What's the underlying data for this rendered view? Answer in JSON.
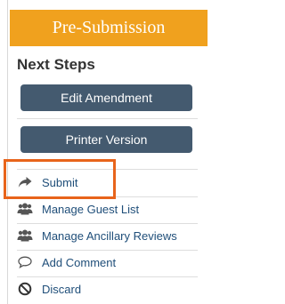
{
  "header": {
    "title": "Pre-Submission"
  },
  "next_steps": {
    "title": "Next Steps",
    "edit_button": "Edit Amendment",
    "printer_button": "Printer Version"
  },
  "actions": [
    {
      "label": "Submit",
      "icon": "share-arrow-icon"
    },
    {
      "label": "Manage Guest List",
      "icon": "users-icon"
    },
    {
      "label": "Manage Ancillary Reviews",
      "icon": "users-icon"
    },
    {
      "label": "Add Comment",
      "icon": "comment-icon"
    },
    {
      "label": "Discard",
      "icon": "no-entry-icon"
    }
  ],
  "colors": {
    "header_bg": "#f0a11e",
    "button_bg": "#445a6f",
    "link": "#1f4e79",
    "highlight": "#e8641b"
  }
}
